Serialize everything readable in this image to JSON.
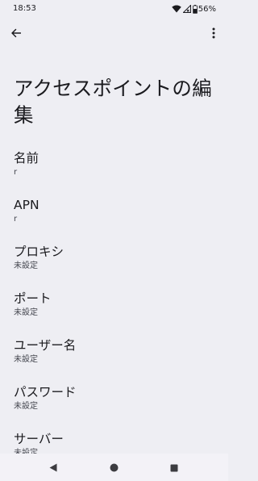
{
  "status_bar": {
    "time": "18:53",
    "battery_percent": "56%",
    "icons": [
      "wifi-icon",
      "signal-icon",
      "battery-icon"
    ]
  },
  "app_bar": {
    "back_icon": "arrow-back-icon",
    "more_icon": "more-vert-icon"
  },
  "page_title": "アクセスポイントの編集",
  "preferences": [
    {
      "title": "名前",
      "summary": "r"
    },
    {
      "title": "APN",
      "summary": "r"
    },
    {
      "title": "プロキシ",
      "summary": "未設定"
    },
    {
      "title": "ポート",
      "summary": "未設定"
    },
    {
      "title": "ユーザー名",
      "summary": "未設定"
    },
    {
      "title": "パスワード",
      "summary": "未設定"
    },
    {
      "title": "サーバー",
      "summary": "未設定"
    }
  ],
  "nav_bar": {
    "icons": [
      "back-triangle-icon",
      "home-circle-icon",
      "recents-square-icon"
    ]
  },
  "colors": {
    "background": "#eeeef3",
    "text_primary": "#1b1b1f",
    "text_secondary": "#44464f"
  }
}
